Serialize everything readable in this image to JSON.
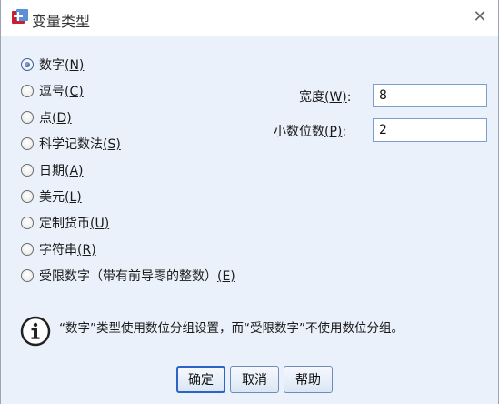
{
  "dialog": {
    "title": "变量类型",
    "close_glyph": "✕"
  },
  "types": [
    {
      "label": "数字",
      "mnemonic": "(N)",
      "checked": true
    },
    {
      "label": "逗号",
      "mnemonic": "(C)",
      "checked": false
    },
    {
      "label": "点",
      "mnemonic": "(D)",
      "checked": false
    },
    {
      "label": "科学记数法",
      "mnemonic": "(S)",
      "checked": false
    },
    {
      "label": "日期",
      "mnemonic": "(A)",
      "checked": false
    },
    {
      "label": "美元",
      "mnemonic": "(L)",
      "checked": false
    },
    {
      "label": "定制货币",
      "mnemonic": "(U)",
      "checked": false
    },
    {
      "label": "字符串",
      "mnemonic": "(R)",
      "checked": false
    },
    {
      "label": "受限数字（带有前导零的整数）",
      "mnemonic": "(E)",
      "checked": false
    }
  ],
  "width_field": {
    "label": "宽度",
    "mnemonic": "(W)",
    "colon": ":",
    "value": "8"
  },
  "decimals_field": {
    "label": "小数位数",
    "mnemonic": "(P)",
    "colon": ":",
    "value": "2"
  },
  "info": {
    "text": "“数字”类型使用数位分组设置，而“受限数字”不使用数位分组。",
    "icon": "info-icon"
  },
  "buttons": {
    "ok": "确定",
    "cancel": "取消",
    "help": "帮助"
  }
}
